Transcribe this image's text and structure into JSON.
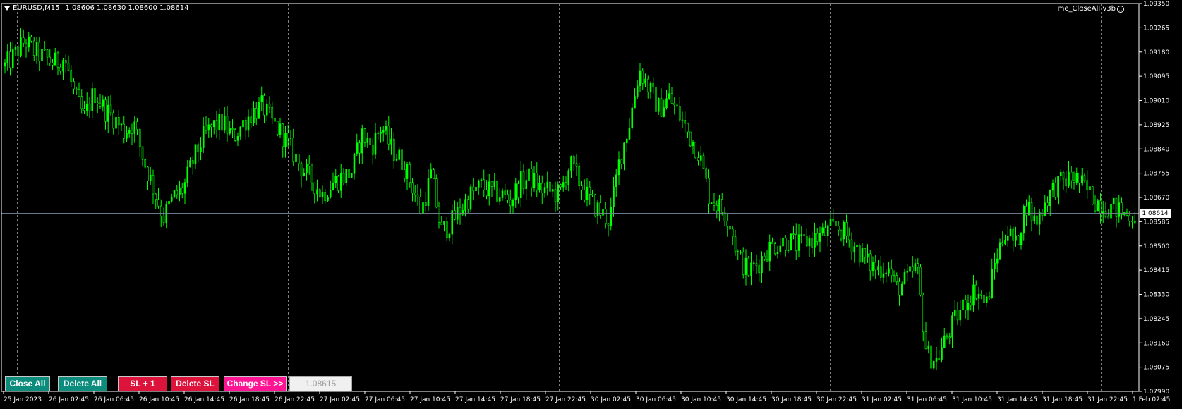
{
  "header": {
    "symbol": "EURUSD,M15",
    "ohlc": "1.08606 1.08630 1.08600 1.08614",
    "ea_label": "me_CloseAll v3b"
  },
  "icons": {
    "dropdown": "triangle-down-icon",
    "ea": "smiley-face-icon"
  },
  "current_price": "1.08614",
  "colors": {
    "background": "#000000",
    "candle": "#00ff00",
    "grid_separator": "#ffffff",
    "price_line": "#778899",
    "axis": "#ffffff"
  },
  "buttons": {
    "close_all": "Close All",
    "delete_all": "Delete All",
    "sl_plus_one": "SL + 1",
    "delete_sl": "Delete SL",
    "change_sl": "Change SL >>"
  },
  "sl_input": {
    "value": "1.08615"
  },
  "chart_data": {
    "type": "candlestick",
    "timeframe": "M15",
    "y_axis_ticks": [
      "1.09350",
      "1.09265",
      "1.09180",
      "1.09095",
      "1.09010",
      "1.08925",
      "1.08840",
      "1.08755",
      "1.08670",
      "1.08585",
      "1.08500",
      "1.08415",
      "1.08330",
      "1.08245",
      "1.08160",
      "1.08075",
      "1.07990"
    ],
    "ylim": [
      1.0799,
      1.0935
    ],
    "x_axis_ticks": [
      "25 Jan 2023",
      "26 Jan 02:45",
      "26 Jan 06:45",
      "26 Jan 10:45",
      "26 Jan 14:45",
      "26 Jan 18:45",
      "26 Jan 22:45",
      "27 Jan 02:45",
      "27 Jan 06:45",
      "27 Jan 10:45",
      "27 Jan 14:45",
      "27 Jan 18:45",
      "27 Jan 22:45",
      "30 Jan 02:45",
      "30 Jan 06:45",
      "30 Jan 10:45",
      "30 Jan 14:45",
      "30 Jan 18:45",
      "30 Jan 22:45",
      "31 Jan 02:45",
      "31 Jan 06:45",
      "31 Jan 10:45",
      "31 Jan 14:45",
      "31 Jan 18:45",
      "31 Jan 22:45",
      "1 Feb 02:45"
    ],
    "day_separators": [
      "26 Jan",
      "27 Jan",
      "30 Jan",
      "31 Jan",
      "1 Feb"
    ],
    "close_path": [
      1.0913,
      1.0917,
      1.0922,
      1.0918,
      1.0916,
      1.0914,
      1.0916,
      1.0903,
      1.0895,
      1.0904,
      1.0898,
      1.0895,
      1.089,
      1.0893,
      1.088,
      1.087,
      1.086,
      1.0867,
      1.087,
      1.088,
      1.0888,
      1.0892,
      1.0893,
      1.0888,
      1.0893,
      1.0897,
      1.0899,
      1.0893,
      1.0889,
      1.0883,
      1.0877,
      1.0873,
      1.0868,
      1.0872,
      1.0874,
      1.0876,
      1.0889,
      1.0885,
      1.0892,
      1.0884,
      1.088,
      1.0872,
      1.0862,
      1.0875,
      1.0855,
      1.0858,
      1.0863,
      1.0868,
      1.0871,
      1.0869,
      1.0868,
      1.0866,
      1.0872,
      1.0874,
      1.087,
      1.0869,
      1.0868,
      1.0879,
      1.0872,
      1.0866,
      1.0862,
      1.0859,
      1.088,
      1.0893,
      1.0912,
      1.0905,
      1.0898,
      1.0902,
      1.0896,
      1.0889,
      1.0883,
      1.0868,
      1.0864,
      1.086,
      1.0846,
      1.0841,
      1.0844,
      1.0849,
      1.0851,
      1.0852,
      1.085,
      1.0852,
      1.0853,
      1.0855,
      1.0857,
      1.0853,
      1.0849,
      1.0844,
      1.0842,
      1.0843,
      1.0835,
      1.0838,
      1.0843,
      1.0812,
      1.081,
      1.0818,
      1.0825,
      1.0831,
      1.0835,
      1.0829,
      1.0846,
      1.0856,
      1.085,
      1.0865,
      1.0858,
      1.0866,
      1.0871,
      1.0873,
      1.0874,
      1.087,
      1.0866,
      1.0864,
      1.0863,
      1.0861,
      1.0861
    ]
  }
}
